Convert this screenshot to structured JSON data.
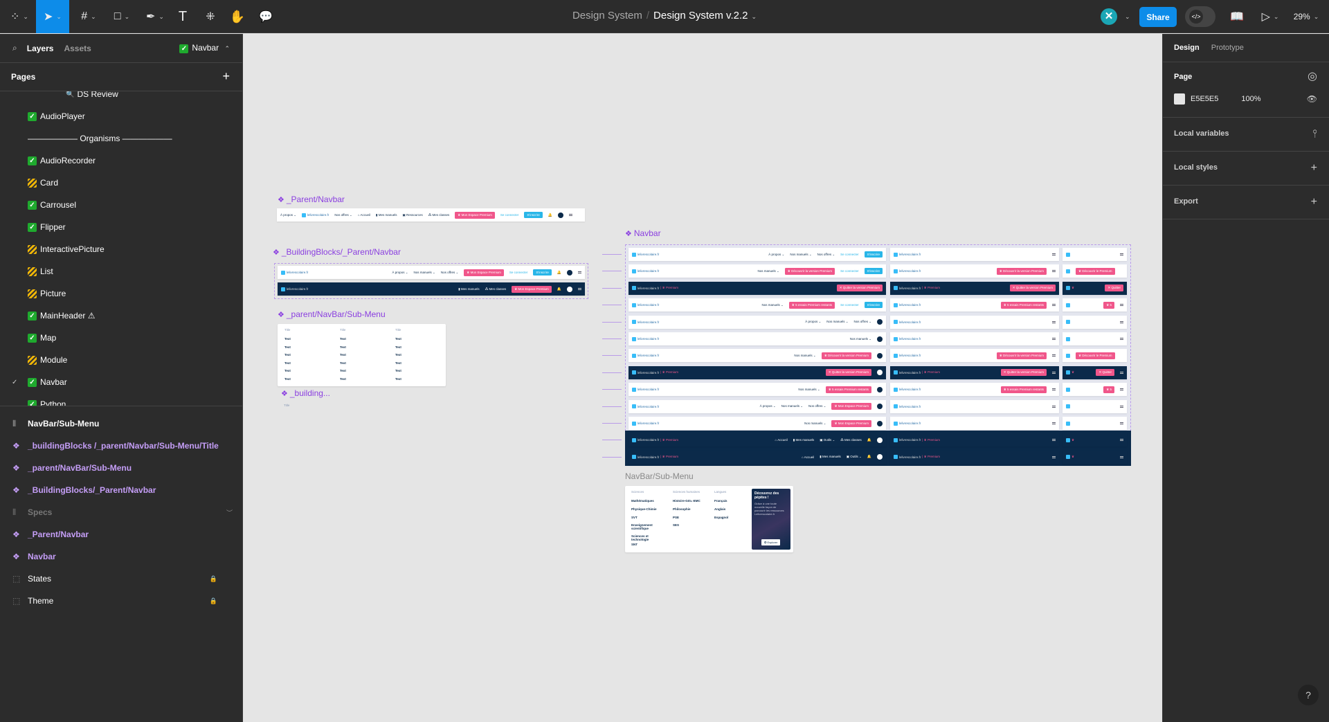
{
  "toolbar": {
    "tools": [
      "figma-menu",
      "move",
      "frame",
      "shape",
      "pen",
      "text",
      "actions",
      "hand",
      "comment"
    ],
    "breadcrumb_project": "Design System",
    "breadcrumb_sep": "/",
    "file_name": "Design System v.2.2",
    "share": "Share",
    "zoom": "29%",
    "user_initial": "✕"
  },
  "left": {
    "tab_layers": "Layers",
    "tab_assets": "Assets",
    "current_page": "Navbar",
    "pages_header": "Pages",
    "pages": [
      {
        "label": "DS Review",
        "status": "search"
      },
      {
        "label": "AudioPlayer",
        "status": "ok"
      },
      {
        "label": "——————  Organisms  ——————",
        "status": "section"
      },
      {
        "label": "AudioRecorder",
        "status": "ok"
      },
      {
        "label": "Card",
        "status": "wip"
      },
      {
        "label": "Carrousel",
        "status": "ok"
      },
      {
        "label": "Flipper",
        "status": "ok"
      },
      {
        "label": "InteractivePicture",
        "status": "wip"
      },
      {
        "label": "List",
        "status": "wip"
      },
      {
        "label": "Picture",
        "status": "wip"
      },
      {
        "label": "MainHeader ⚠",
        "status": "ok"
      },
      {
        "label": "Map",
        "status": "ok"
      },
      {
        "label": "Module",
        "status": "wip"
      },
      {
        "label": "Navbar",
        "status": "ok",
        "selected": true
      },
      {
        "label": "Python",
        "status": "ok"
      }
    ],
    "layers": [
      {
        "label": "NavBar/Sub-Menu",
        "kind": "section"
      },
      {
        "label": "_buildingBlocks /_parent/Navbar/Sub-Menu/Title",
        "kind": "component"
      },
      {
        "label": "_parent/NavBar/Sub-Menu",
        "kind": "component"
      },
      {
        "label": "_BuildingBlocks/_Parent/Navbar",
        "kind": "component"
      },
      {
        "label": "Specs",
        "kind": "hidden-section"
      },
      {
        "label": "_Parent/Navbar",
        "kind": "component"
      },
      {
        "label": "Navbar",
        "kind": "component"
      },
      {
        "label": "States",
        "kind": "locked-frame"
      },
      {
        "label": "Theme",
        "kind": "locked-frame"
      }
    ]
  },
  "right": {
    "tab_design": "Design",
    "tab_prototype": "Prototype",
    "page_label": "Page",
    "bg_hex": "E5E5E5",
    "bg_opacity": "100%",
    "bg_color": "#E5E5E5",
    "local_variables": "Local variables",
    "local_styles": "Local styles",
    "export": "Export"
  },
  "canvas": {
    "labels": {
      "parent_navbar": "_Parent/Navbar",
      "building_blocks": "_BuildingBlocks/_Parent/Navbar",
      "parent_submenu": "_parent/NavBar/Sub-Menu",
      "building_short": "_building...",
      "navbar": "Navbar",
      "submenu_section": "NavBar/Sub-Menu"
    },
    "brand": "lelivrescolaire.fr",
    "premium": "Premium",
    "colors": {
      "navy": "#0b2a4a",
      "pink": "#f0568a",
      "cyan": "#29b6e8",
      "component": "#8a3ee0"
    },
    "parent_navbar": {
      "theme": "light",
      "items": [
        [
          "txt",
          "À propos ⌄"
        ],
        [
          "logo",
          ""
        ],
        [
          "txt",
          "Nos offres ⌄"
        ],
        [
          "txt",
          "⌂ Accueil"
        ],
        [
          "txt",
          "▮ Mes manuels"
        ],
        [
          "txt",
          "▣ Ressources"
        ],
        [
          "txt",
          "⁂ Mes classes"
        ],
        [
          "pink",
          "♛ Mon Espace Premium"
        ],
        [
          "conn",
          "Se connecter"
        ],
        [
          "cyan",
          "S'inscrire"
        ],
        [
          "bell",
          "🔔"
        ],
        [
          "av",
          ""
        ],
        [
          "burger",
          ""
        ]
      ]
    },
    "bb_rows": [
      {
        "theme": "light",
        "items": [
          [
            "logo",
            ""
          ],
          [
            "sp",
            ""
          ],
          [
            "txt",
            "À propos ⌄"
          ],
          [
            "txt",
            "Nos manuels ⌄"
          ],
          [
            "txt",
            "Nos offres ⌄"
          ],
          [
            "pink",
            "♛ Mon Espace Premium"
          ],
          [
            "conn",
            "Se connecter"
          ],
          [
            "cyan",
            "S'inscrire"
          ],
          [
            "bell",
            "🔔"
          ],
          [
            "av",
            ""
          ],
          [
            "burger",
            ""
          ]
        ]
      },
      {
        "theme": "dark",
        "items": [
          [
            "logo",
            ""
          ],
          [
            "sp",
            ""
          ],
          [
            "txt",
            "▮ Mes manuels"
          ],
          [
            "txt",
            "⁂ Mes classes"
          ],
          [
            "pink",
            "♛ Mon Espace Premium"
          ],
          [
            "bell",
            "🔔"
          ],
          [
            "av",
            ""
          ],
          [
            "burger",
            ""
          ]
        ]
      }
    ],
    "navbar_rows": [
      {
        "theme": "light",
        "c1": [
          [
            "logo",
            ""
          ],
          [
            "sp",
            ""
          ],
          [
            "txt",
            "À propos ⌄"
          ],
          [
            "txt",
            "Nos manuels ⌄"
          ],
          [
            "txt",
            "Nos offres ⌄"
          ],
          [
            "conn",
            "Se connecter"
          ],
          [
            "cyan",
            "S'inscrire"
          ]
        ],
        "c2": [
          [
            "logo",
            ""
          ],
          [
            "sp",
            ""
          ],
          [
            "burger",
            ""
          ]
        ],
        "c3": [
          [
            "logoi",
            ""
          ],
          [
            "sp",
            ""
          ],
          [
            "burger",
            ""
          ]
        ]
      },
      {
        "theme": "light",
        "c1": [
          [
            "logo",
            ""
          ],
          [
            "sp",
            ""
          ],
          [
            "txt",
            "Nos manuels ⌄"
          ],
          [
            "pink",
            "♛ Découvrir la version Premium"
          ],
          [
            "conn",
            "Se connecter"
          ],
          [
            "cyan",
            "S'inscrire"
          ]
        ],
        "c2": [
          [
            "logo",
            ""
          ],
          [
            "sp",
            ""
          ],
          [
            "pink",
            "♛ Découvrir la version Premium"
          ],
          [
            "burger",
            ""
          ]
        ],
        "c3": [
          [
            "logoi",
            ""
          ],
          [
            "pink",
            "♛ Découvrir le Premium"
          ],
          [
            "sp",
            ""
          ],
          [
            "burger",
            ""
          ]
        ]
      },
      {
        "theme": "dark",
        "c1": [
          [
            "logop",
            ""
          ],
          [
            "sp",
            ""
          ],
          [
            "pink",
            "✕ Quitter la version Premium"
          ]
        ],
        "c2": [
          [
            "logop",
            ""
          ],
          [
            "sp",
            ""
          ],
          [
            "pink",
            "✕ Quitter la version Premium"
          ]
        ],
        "c3": [
          [
            "logoi",
            ""
          ],
          [
            "sp",
            ""
          ],
          [
            "pink",
            "✕ Quitter"
          ]
        ]
      },
      {
        "theme": "light",
        "c1": [
          [
            "logo",
            ""
          ],
          [
            "sp",
            ""
          ],
          [
            "txt",
            "Nos manuels ⌄"
          ],
          [
            "pink",
            "♛ 5 essais Premium restants"
          ],
          [
            "conn",
            "Se connecter"
          ],
          [
            "cyan",
            "S'inscrire"
          ]
        ],
        "c2": [
          [
            "logo",
            ""
          ],
          [
            "sp",
            ""
          ],
          [
            "pink",
            "♛ 5 essais Premium restants"
          ],
          [
            "burger",
            ""
          ]
        ],
        "c3": [
          [
            "logoi",
            ""
          ],
          [
            "sp",
            ""
          ],
          [
            "pink",
            "♛ 5"
          ],
          [
            "burger",
            ""
          ]
        ]
      },
      {
        "theme": "light",
        "c1": [
          [
            "logo",
            ""
          ],
          [
            "sp",
            ""
          ],
          [
            "txt",
            "À propos ⌄"
          ],
          [
            "txt",
            "Nos manuels ⌄"
          ],
          [
            "txt",
            "Nos offres ⌄"
          ],
          [
            "av",
            ""
          ]
        ],
        "c2": [
          [
            "logo",
            ""
          ],
          [
            "sp",
            ""
          ],
          [
            "burger",
            ""
          ]
        ],
        "c3": [
          [
            "logoi",
            ""
          ],
          [
            "sp",
            ""
          ],
          [
            "burger",
            ""
          ]
        ]
      },
      {
        "theme": "light",
        "c1": [
          [
            "logo",
            ""
          ],
          [
            "sp",
            ""
          ],
          [
            "txt",
            "Nos manuels ⌄"
          ],
          [
            "av",
            ""
          ]
        ],
        "c2": [
          [
            "logo",
            ""
          ],
          [
            "sp",
            ""
          ],
          [
            "burger",
            ""
          ]
        ],
        "c3": [
          [
            "logoi",
            ""
          ],
          [
            "sp",
            ""
          ],
          [
            "burger",
            ""
          ]
        ]
      },
      {
        "theme": "light",
        "c1": [
          [
            "logo",
            ""
          ],
          [
            "sp",
            ""
          ],
          [
            "txt",
            "Nos manuels ⌄"
          ],
          [
            "pink",
            "♛ Découvrir la version Premium"
          ],
          [
            "av",
            ""
          ]
        ],
        "c2": [
          [
            "logo",
            ""
          ],
          [
            "sp",
            ""
          ],
          [
            "pink",
            "♛ Découvrir la version Premium"
          ],
          [
            "burger",
            ""
          ]
        ],
        "c3": [
          [
            "logoi",
            ""
          ],
          [
            "pink",
            "♛ Découvrir le Premium"
          ],
          [
            "sp",
            ""
          ],
          [
            "burger",
            ""
          ]
        ]
      },
      {
        "theme": "dark",
        "c1": [
          [
            "logop",
            ""
          ],
          [
            "sp",
            ""
          ],
          [
            "pink",
            "✕ Quitter la version Premium"
          ],
          [
            "av",
            ""
          ]
        ],
        "c2": [
          [
            "logop",
            ""
          ],
          [
            "sp",
            ""
          ],
          [
            "pink",
            "✕ Quitter la version Premium"
          ],
          [
            "burger",
            ""
          ]
        ],
        "c3": [
          [
            "logoi",
            ""
          ],
          [
            "sp",
            ""
          ],
          [
            "pink",
            "✕ Quitter"
          ],
          [
            "burger",
            ""
          ]
        ]
      },
      {
        "theme": "light",
        "c1": [
          [
            "logo",
            ""
          ],
          [
            "sp",
            ""
          ],
          [
            "txt",
            "Nos manuels ⌄"
          ],
          [
            "pink",
            "♛ 5 essais Premium restants"
          ],
          [
            "av",
            ""
          ]
        ],
        "c2": [
          [
            "logo",
            ""
          ],
          [
            "sp",
            ""
          ],
          [
            "pink",
            "♛ 5 essais Premium restants"
          ],
          [
            "burger",
            ""
          ]
        ],
        "c3": [
          [
            "logoi",
            ""
          ],
          [
            "sp",
            ""
          ],
          [
            "pink",
            "♛ 5"
          ],
          [
            "burger",
            ""
          ]
        ]
      },
      {
        "theme": "light",
        "c1": [
          [
            "logo",
            ""
          ],
          [
            "sp",
            ""
          ],
          [
            "txt",
            "À propos ⌄"
          ],
          [
            "txt",
            "Nos manuels ⌄"
          ],
          [
            "txt",
            "Nos offres ⌄"
          ],
          [
            "pink",
            "♛ Mon Espace Premium"
          ],
          [
            "av",
            ""
          ]
        ],
        "c2": [
          [
            "logo",
            ""
          ],
          [
            "sp",
            ""
          ],
          [
            "burger",
            ""
          ]
        ],
        "c3": [
          [
            "logoi",
            ""
          ],
          [
            "sp",
            ""
          ],
          [
            "burger",
            ""
          ]
        ]
      },
      {
        "theme": "light",
        "c1": [
          [
            "logo",
            ""
          ],
          [
            "sp",
            ""
          ],
          [
            "txt",
            "Nos manuels ⌄"
          ],
          [
            "pink",
            "♛ Mon Espace Premium"
          ],
          [
            "av",
            ""
          ]
        ],
        "c2": [
          [
            "logo",
            ""
          ],
          [
            "sp",
            ""
          ],
          [
            "burger",
            ""
          ]
        ],
        "c3": [
          [
            "logoi",
            ""
          ],
          [
            "sp",
            ""
          ],
          [
            "burger",
            ""
          ]
        ]
      },
      {
        "theme": "dark",
        "c1": [
          [
            "logop",
            ""
          ],
          [
            "sp",
            ""
          ],
          [
            "txt",
            "⌂ Accueil"
          ],
          [
            "txt",
            "▮ Mes manuels"
          ],
          [
            "txt",
            "▣ Outils ⌄"
          ],
          [
            "txt",
            "⁂ Mes classes"
          ],
          [
            "bell",
            "🔔"
          ],
          [
            "av",
            ""
          ]
        ],
        "c2": [
          [
            "logop",
            ""
          ],
          [
            "sp",
            ""
          ],
          [
            "burger",
            ""
          ]
        ],
        "c3": [
          [
            "logoi",
            ""
          ],
          [
            "sp",
            ""
          ],
          [
            "burger",
            ""
          ]
        ]
      },
      {
        "theme": "dark",
        "c1": [
          [
            "logop",
            ""
          ],
          [
            "sp",
            ""
          ],
          [
            "txt",
            "⌂ Accueil"
          ],
          [
            "txt",
            "▮ Mes manuels"
          ],
          [
            "txt",
            "▣ Outils ⌄"
          ],
          [
            "bell",
            "🔔"
          ],
          [
            "av",
            ""
          ]
        ],
        "c2": [
          [
            "logop",
            ""
          ],
          [
            "sp",
            ""
          ],
          [
            "burger",
            ""
          ]
        ],
        "c3": [
          [
            "logoi",
            ""
          ],
          [
            "sp",
            ""
          ],
          [
            "burger",
            ""
          ]
        ]
      }
    ],
    "parent_submenu": {
      "columns": [
        {
          "title": "Title",
          "items": [
            "Text",
            "Text",
            "Text",
            "Text",
            "Text",
            "Text"
          ]
        },
        {
          "title": "Title",
          "items": [
            "Text",
            "Text",
            "Text",
            "Text",
            "Text",
            "Text"
          ]
        },
        {
          "title": "Title",
          "items": [
            "Text",
            "Text",
            "Text",
            "Text",
            "Text",
            "Text"
          ]
        }
      ],
      "building_title": "Title"
    },
    "submenu": {
      "columns": [
        {
          "title": "Sciences",
          "items": [
            "Mathématiques",
            "Physique-Chimie",
            "SVT",
            "Enseignement scientifique",
            "Sciences et technologie",
            "SNT"
          ]
        },
        {
          "title": "Sciences humaines",
          "items": [
            "Histoire-Géo.-EMC",
            "Philosophie",
            "PSE",
            "SES"
          ]
        },
        {
          "title": "Langues",
          "items": [
            "Français",
            "Anglais",
            "Espagnol"
          ]
        }
      ],
      "promo": {
        "title": "Découvrez des pépites !",
        "body": "Grâce à une toute nouvelle façon de parcourir les ressources Lelivrescolaire.fr",
        "button": "✪ Explorer"
      }
    }
  },
  "help": "?"
}
